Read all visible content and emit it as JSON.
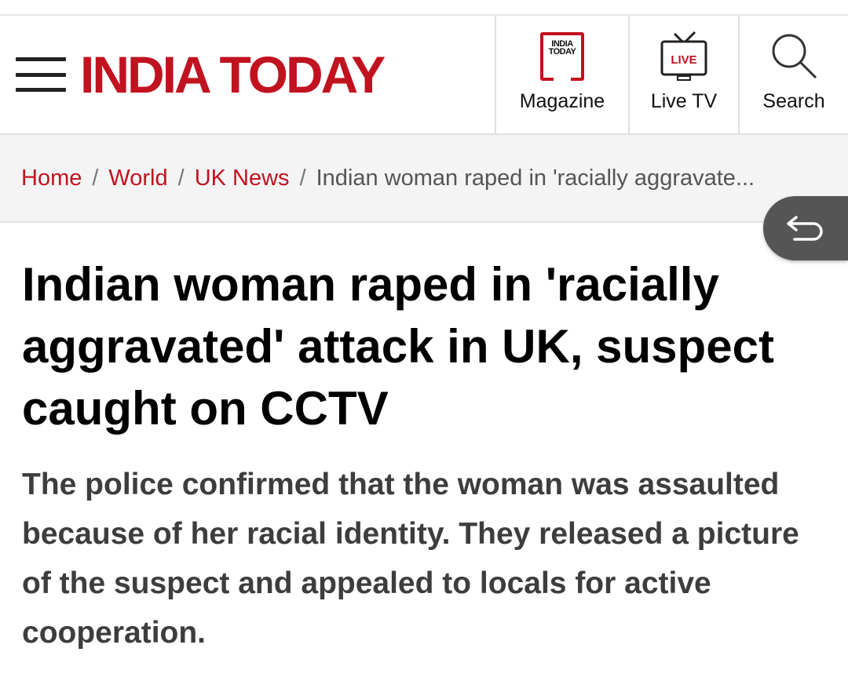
{
  "header": {
    "logo_text": "INDIA TODAY",
    "nav": [
      {
        "label": "Magazine",
        "icon": "magazine-icon",
        "icon_text": "INDIA TODAY"
      },
      {
        "label": "Live TV",
        "icon": "live-tv-icon",
        "icon_text": "LIVE"
      },
      {
        "label": "Search",
        "icon": "search-icon"
      }
    ]
  },
  "breadcrumb": {
    "items": [
      "Home",
      "World",
      "UK News"
    ],
    "separator": "/",
    "current": "Indian woman raped in 'racially aggravate..."
  },
  "article": {
    "headline": "Indian woman raped in 'racially aggravated' attack in UK, suspect caught on CCTV",
    "summary": "The police confirmed that the woman was assaulted because of her racial identity. They released a picture of the suspect and appealed to locals for active cooperation."
  },
  "colors": {
    "brand_red": "#c1121f",
    "breadcrumb_bg": "#f4f4f5",
    "summary_text": "#3d3d3d"
  }
}
